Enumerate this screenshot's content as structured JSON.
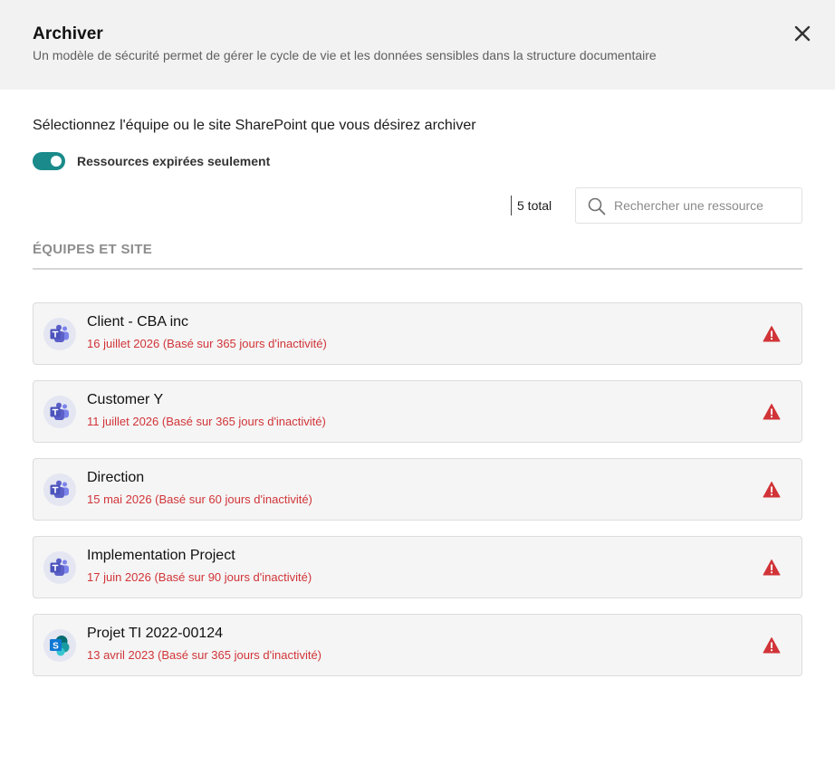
{
  "dialog": {
    "title": "Archiver",
    "subtitle": "Un modèle de sécurité permet de gérer le cycle de vie et les données sensibles dans la structure documentaire",
    "close_icon": "close-icon"
  },
  "instruction": "Sélectionnez l'équipe ou le site SharePoint que vous désirez archiver",
  "toggle": {
    "label": "Ressources expirées seulement",
    "checked": true,
    "color": "#1a8a8a"
  },
  "total": "5 total",
  "search": {
    "placeholder": "Rechercher une ressource",
    "value": "",
    "icon": "search-icon"
  },
  "section": {
    "header": "ÉQUIPES ET SITE"
  },
  "items": [
    {
      "title": "Client - CBA inc",
      "date": "16 juillet 2026 (Basé sur 365 jours d'inactivité)",
      "icon": "teams-icon"
    },
    {
      "title": "Customer Y",
      "date": "11 juillet 2026 (Basé sur 365 jours d'inactivité)",
      "icon": "teams-icon"
    },
    {
      "title": "Direction",
      "date": "15 mai 2026 (Basé sur 60 jours d'inactivité)",
      "icon": "teams-icon"
    },
    {
      "title": "Implementation Project",
      "date": "17 juin 2026 (Basé sur 90 jours d'inactivité)",
      "icon": "teams-icon"
    },
    {
      "title": "Projet TI 2022-00124",
      "date": "13 avril 2023 (Basé sur 365 jours d'inactivité)",
      "icon": "sharepoint-icon"
    }
  ],
  "colors": {
    "warning": "#d13438",
    "teams": "#5b5fc7",
    "sharepoint": "#0f78d4"
  }
}
